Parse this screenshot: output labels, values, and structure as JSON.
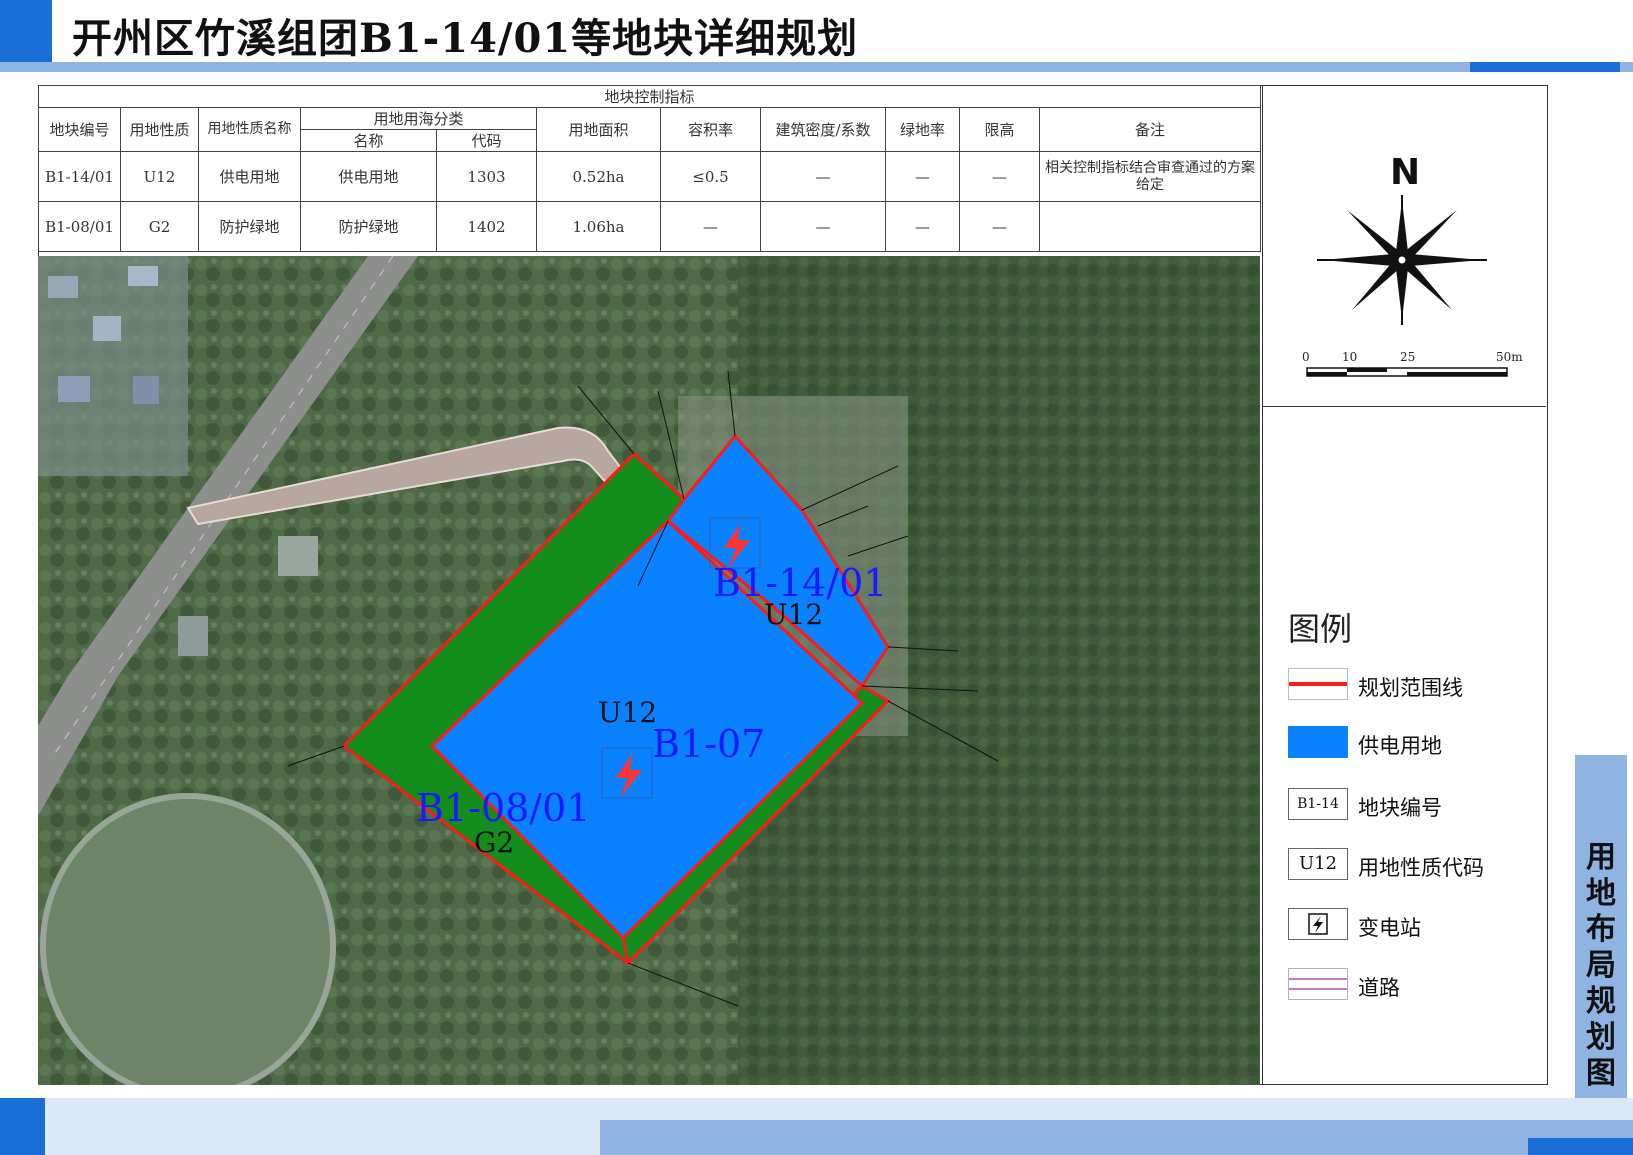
{
  "title": "开州区竹溪组团B1-14/01等地块详细规划",
  "table": {
    "group_header": "地块控制指标",
    "headers": [
      "地块编号",
      "用地性质",
      "用地性质名称",
      "用地用海分类",
      "用地面积",
      "容积率",
      "建筑密度/系数",
      "绿地率",
      "限高",
      "备注"
    ],
    "sub_headers": [
      "名称",
      "代码"
    ],
    "rows": [
      [
        "B1-14/01",
        "U12",
        "供电用地",
        "供电用地",
        "1303",
        "0.52ha",
        "≤0.5",
        "—",
        "—",
        "—",
        "相关控制指标结合审查通过的方案给定"
      ],
      [
        "B1-08/01",
        "G2",
        "防护绿地",
        "防护绿地",
        "1402",
        "1.06ha",
        "—",
        "—",
        "—",
        "—",
        ""
      ]
    ]
  },
  "map": {
    "parcel_labels": [
      {
        "code": "B1-14/01",
        "type": "U12"
      },
      {
        "code": "B1-07",
        "type": "U12"
      },
      {
        "code": "B1-08/01",
        "type": "G2"
      }
    ],
    "colors": {
      "power": "#0a82ff",
      "green": "#138d1c",
      "boundary": "#ff1a1a",
      "road": "#b8a6a0"
    }
  },
  "compass": {
    "north": "N"
  },
  "scale": {
    "ticks": [
      "0",
      "10",
      "25",
      "50m"
    ]
  },
  "legend": {
    "title": "图例",
    "items": [
      {
        "icon": "boundary-line-icon",
        "label": "规划范围线"
      },
      {
        "icon": "power-land-swatch",
        "label": "供电用地"
      },
      {
        "icon": "parcel-code-box",
        "sample": "B1-14",
        "label": "地块编号"
      },
      {
        "icon": "land-type-box",
        "sample": "U12",
        "label": "用地性质代码"
      },
      {
        "icon": "substation-icon",
        "label": "变电站"
      },
      {
        "icon": "road-icon",
        "label": "道路"
      }
    ]
  },
  "side_tab": "用地布局规划图"
}
